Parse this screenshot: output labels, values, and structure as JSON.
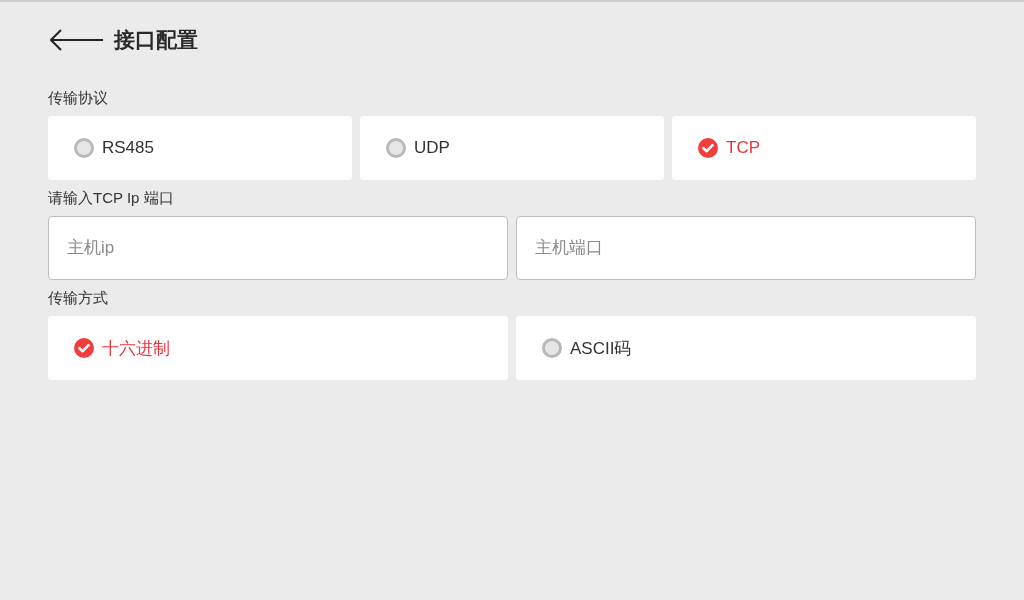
{
  "header": {
    "title": "接口配置"
  },
  "protocol": {
    "label": "传输协议",
    "options": [
      {
        "label": "RS485",
        "selected": false
      },
      {
        "label": "UDP",
        "selected": false
      },
      {
        "label": "TCP",
        "selected": true
      }
    ]
  },
  "tcp": {
    "label": "请输入TCP Ip 端口",
    "fields": [
      {
        "placeholder": "主机ip"
      },
      {
        "placeholder": "主机端口"
      }
    ]
  },
  "mode": {
    "label": "传输方式",
    "options": [
      {
        "label": "十六进制",
        "selected": true
      },
      {
        "label": "ASCII码",
        "selected": false
      }
    ]
  }
}
